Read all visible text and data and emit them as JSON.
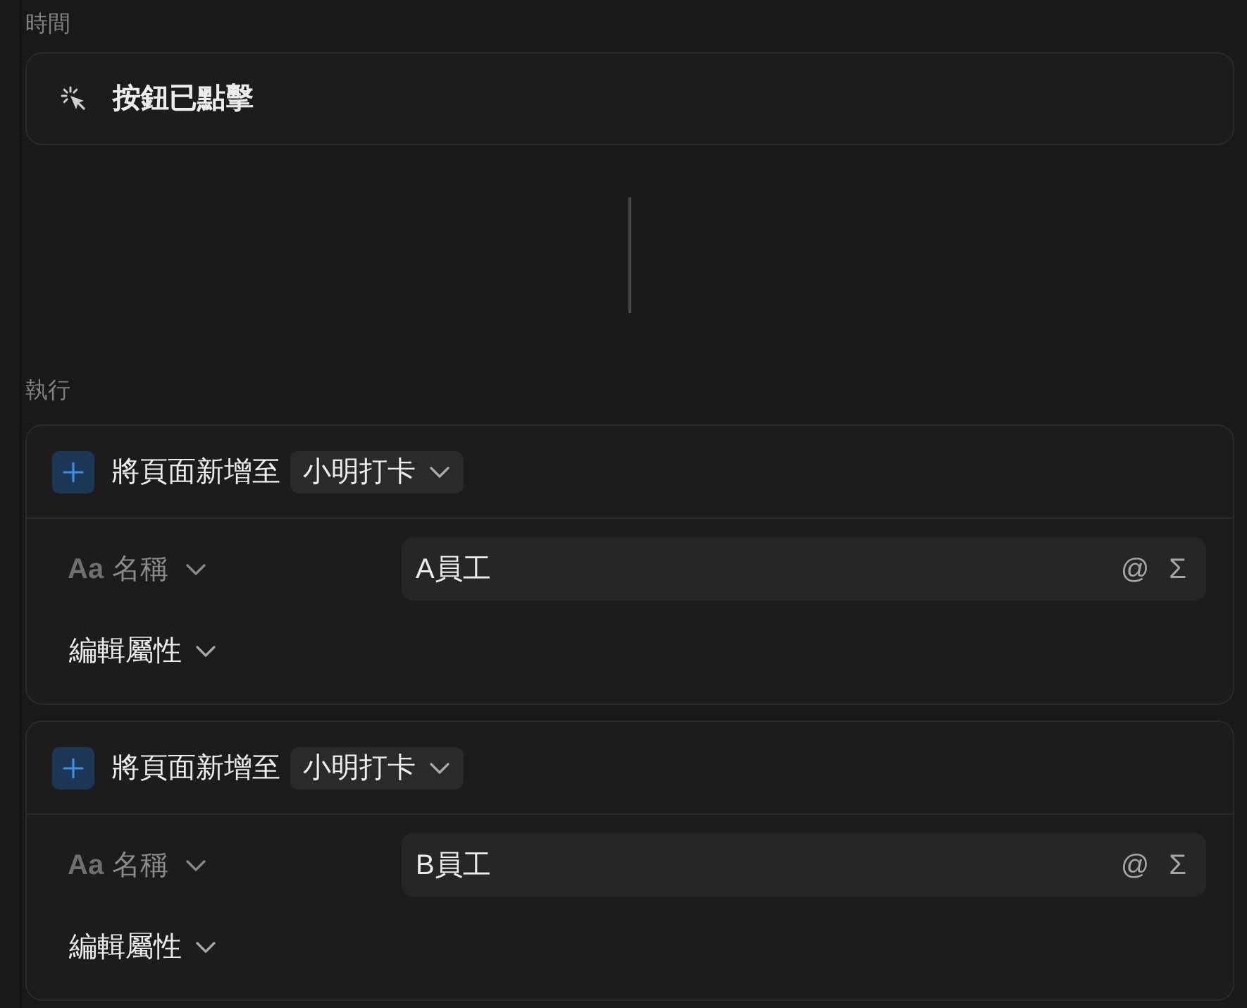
{
  "trigger": {
    "section_label": "時間",
    "label": "按鈕已點擊"
  },
  "actions_label": "執行",
  "actions": [
    {
      "kind": "add_page",
      "title": "將頁面新增至",
      "database": "小明打卡",
      "property": {
        "type_icon": "Aa",
        "name": "名稱",
        "value": "A員工",
        "buttons": [
          "@",
          "Σ"
        ]
      },
      "edit_label": "編輯屬性"
    },
    {
      "kind": "add_page",
      "title": "將頁面新增至",
      "database": "小明打卡",
      "property": {
        "type_icon": "Aa",
        "name": "名稱",
        "value": "B員工",
        "buttons": [
          "@",
          "Σ"
        ]
      },
      "edit_label": "編輯屬性"
    }
  ]
}
